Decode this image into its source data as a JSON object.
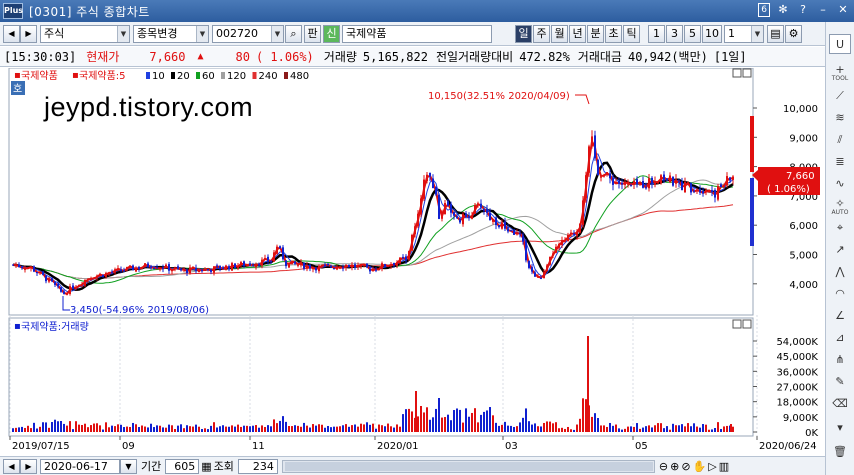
{
  "window": {
    "title": "[0301] 주식 종합차트",
    "logo": "Plus",
    "window_number": "6",
    "icons": [
      "pin-icon",
      "help-icon",
      "minimize-icon",
      "close-icon"
    ]
  },
  "toolbar": {
    "market": "주식",
    "mode": "종목변경",
    "code": "002720",
    "search_icon": "search-icon",
    "btn_pan": "판",
    "btn_sin": "신",
    "stock_name": "국제약품",
    "periods": [
      "일",
      "주",
      "월",
      "년",
      "분",
      "초",
      "틱"
    ],
    "active_period": "일",
    "numbers": [
      "1",
      "3",
      "5",
      "10"
    ],
    "count": "1"
  },
  "info": {
    "time": "[15:30:03]",
    "price_label": "현재가",
    "price": "7,660",
    "change_arrow": "▲",
    "change": "80",
    "change_pct": "( 1.06%)",
    "volume_label": "거래량",
    "volume": "5,165,822",
    "prev_ratio_label": "전일거래량대비",
    "prev_ratio": "472.82%",
    "amount_label": "거래대금",
    "amount": "40,942(백만)",
    "period_tag": "[1일]"
  },
  "price_panel": {
    "side_badge": "호",
    "legend_stock": "국제약품",
    "legend_ma_label": "국제약품:5",
    "legend_items": [
      {
        "label": "10",
        "color": "#2040e0"
      },
      {
        "label": "20",
        "color": "#000000"
      },
      {
        "label": "60",
        "color": "#10a020"
      },
      {
        "label": "120",
        "color": "#a0a0a0"
      },
      {
        "label": "240",
        "color": "#e03030"
      },
      {
        "label": "480",
        "color": "#8b1a1a"
      }
    ],
    "high_annotation": "10,150(32.51% 2020/04/09)",
    "low_annotation": "3,450(-54.96% 2019/08/06)",
    "current_tag_price": "7,660",
    "current_tag_pct": "( 1.06%)",
    "y_ticks": [
      "10,000",
      "9,000",
      "8,000",
      "7,000",
      "6,000",
      "5,000",
      "4,000"
    ]
  },
  "volume_panel": {
    "legend": "국제약품:거래량",
    "y_ticks": [
      "54,000K",
      "45,000K",
      "36,000K",
      "27,000K",
      "18,000K",
      "9,000K",
      "0K"
    ]
  },
  "x_axis": {
    "labels": [
      "2019/07/15",
      "09",
      "11",
      "2020/01",
      "03",
      "05",
      "2020/06/24"
    ]
  },
  "bottom": {
    "date": "2020-06-17",
    "period_label": "기간",
    "period_value": "605",
    "query_label": "조회",
    "query_value": "234"
  },
  "sidebar": {
    "tool_label": "TOOL",
    "auto_label": "AUTO"
  },
  "watermark": "jeypd.tistory.com",
  "colors": {
    "up": "#e01010",
    "down": "#1020d0",
    "ma5": "#e01010",
    "ma10": "#2040e0",
    "ma20": "#000000",
    "ma60": "#10a020",
    "ma120": "#a0a0a0",
    "ma240": "#e03030"
  }
}
